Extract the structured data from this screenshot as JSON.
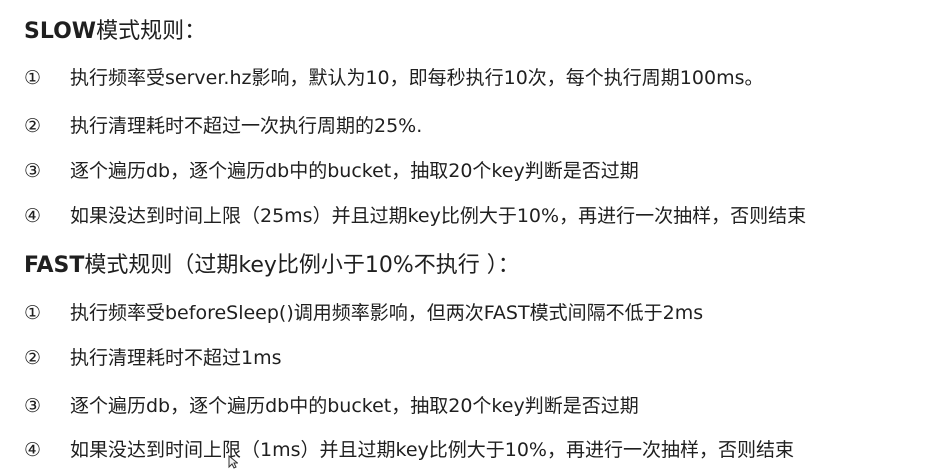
{
  "slow": {
    "keyword": "SLOW",
    "suffix": "模式规则：",
    "items": [
      {
        "num": "①",
        "text": "执行频率受server.hz影响，默认为10，即每秒执行10次，每个执行周期100ms。"
      },
      {
        "num": "②",
        "text": "执行清理耗时不超过一次执行周期的25%."
      },
      {
        "num": "③",
        "text": "逐个遍历db，逐个遍历db中的bucket，抽取20个key判断是否过期"
      },
      {
        "num": "④",
        "text": "如果没达到时间上限（25ms）并且过期key比例大于10%，再进行一次抽样，否则结束"
      }
    ]
  },
  "fast": {
    "keyword": "FAST",
    "suffix": "模式规则（过期key比例小于10%不执行 ）：",
    "items": [
      {
        "num": "①",
        "text": "执行频率受beforeSleep()调用频率影响，但两次FAST模式间隔不低于2ms"
      },
      {
        "num": "②",
        "text": "执行清理耗时不超过1ms"
      },
      {
        "num": "③",
        "text": "逐个遍历db，逐个遍历db中的bucket，抽取20个key判断是否过期"
      },
      {
        "num": "④",
        "text": "如果没达到时间上限（1ms）并且过期key比例大于10%，再进行一次抽样，否则结束"
      }
    ]
  }
}
